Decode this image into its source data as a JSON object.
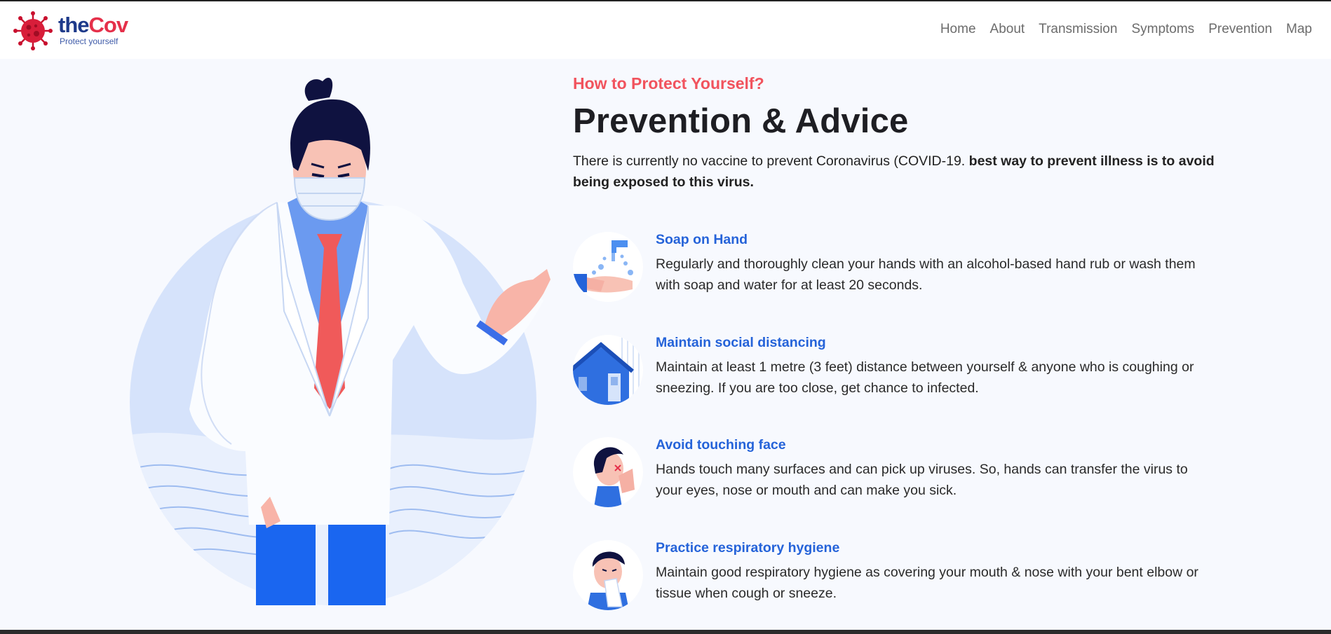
{
  "brand": {
    "name_part1": "the",
    "name_part2": "Cov",
    "tagline": "Protect yourself"
  },
  "nav": {
    "items": [
      "Home",
      "About",
      "Transmission",
      "Symptoms",
      "Prevention",
      "Map"
    ]
  },
  "hero": {
    "kicker": "How to Protect Yourself?",
    "title": "Prevention & Advice",
    "lead_plain": "There is currently no vaccine to prevent Coronavirus (COVID-19. ",
    "lead_bold": "best way to prevent illness is to avoid being exposed to this virus."
  },
  "advice": [
    {
      "icon": "hand-wash-icon",
      "title": "Soap on Hand",
      "text": "Regularly and thoroughly clean your hands with an alcohol-based hand rub or wash them with soap and water for at least 20 seconds."
    },
    {
      "icon": "house-icon",
      "title": "Maintain social distancing",
      "text": "Maintain at least 1 metre (3 feet) distance between yourself & anyone who is coughing or sneezing. If you are too close, get chance to infected."
    },
    {
      "icon": "face-touch-icon",
      "title": "Avoid touching face",
      "text": "Hands touch many surfaces and can pick up viruses. So, hands can transfer the virus to your eyes, nose or mouth and can make you sick."
    },
    {
      "icon": "sneeze-icon",
      "title": "Practice respiratory hygiene",
      "text": "Maintain good respiratory hygiene as covering your mouth & nose with your bent elbow or tissue when cough or sneeze."
    }
  ],
  "colors": {
    "accent_red": "#f1535d",
    "link_blue": "#2563d9",
    "brand_navy": "#1e3a8a",
    "brand_red": "#e5304a",
    "background": "#f7f9fe"
  }
}
